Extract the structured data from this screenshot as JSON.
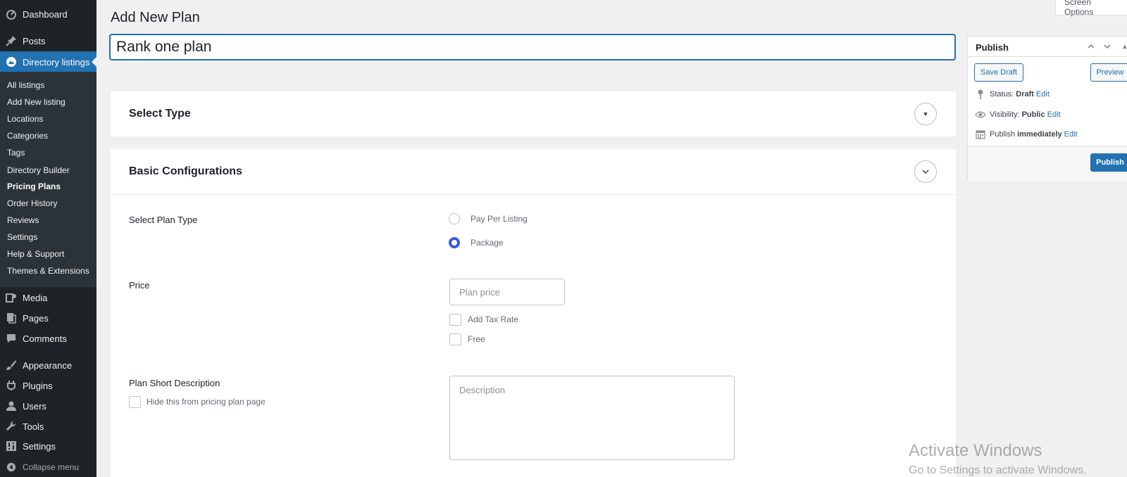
{
  "sidebar": {
    "top_items": [
      {
        "label": "Dashboard",
        "icon": "dashboard-icon"
      },
      {
        "label": "Posts",
        "icon": "pin-icon"
      },
      {
        "label": "Directory listings",
        "icon": "directory-icon"
      }
    ],
    "sub_items": [
      {
        "label": "All listings"
      },
      {
        "label": "Add New listing"
      },
      {
        "label": "Locations"
      },
      {
        "label": "Categories"
      },
      {
        "label": "Tags"
      },
      {
        "label": "Directory Builder"
      },
      {
        "label": "Pricing Plans"
      },
      {
        "label": "Order History"
      },
      {
        "label": "Reviews"
      },
      {
        "label": "Settings"
      },
      {
        "label": "Help & Support"
      },
      {
        "label": "Themes & Extensions"
      }
    ],
    "bottom_items": [
      {
        "label": "Media",
        "icon": "media-icon"
      },
      {
        "label": "Pages",
        "icon": "pages-icon"
      },
      {
        "label": "Comments",
        "icon": "comment-icon"
      },
      {
        "label": "Appearance",
        "icon": "brush-icon"
      },
      {
        "label": "Plugins",
        "icon": "plugin-icon"
      },
      {
        "label": "Users",
        "icon": "user-icon"
      },
      {
        "label": "Tools",
        "icon": "wrench-icon"
      },
      {
        "label": "Settings",
        "icon": "settings-icon"
      }
    ],
    "collapse_label": "Collapse menu"
  },
  "header": {
    "title": "Add New Plan",
    "screen_options": "Screen Options"
  },
  "title_input": {
    "value": "Rank one plan"
  },
  "select_type": {
    "title": "Select Type"
  },
  "basic_config": {
    "title": "Basic Configurations",
    "plan_type_label": "Select Plan Type",
    "plan_type_options": [
      "Pay Per Listing",
      "Package"
    ],
    "plan_type_selected": "Package",
    "price_label": "Price",
    "price_placeholder": "Plan price",
    "add_tax_label": "Add Tax Rate",
    "free_label": "Free",
    "short_desc_label": "Plan Short Description",
    "hide_label": "Hide this from pricing plan page",
    "description_placeholder": "Description"
  },
  "publish": {
    "title": "Publish",
    "save_draft": "Save Draft",
    "preview": "Preview",
    "status_label": "Status:",
    "status_value": "Draft",
    "visibility_label": "Visibility:",
    "visibility_value": "Public",
    "publish_label": "Publish",
    "publish_value": "immediately",
    "edit": "Edit",
    "publish_button": "Publish"
  },
  "watermark": {
    "line1": "Activate Windows",
    "line2": "Go to Settings to activate Windows."
  },
  "colors": {
    "sidebar_bg": "#1d2327",
    "submenu_bg": "#2c3338",
    "accent": "#2271b1",
    "radio_checked": "#3858e9"
  }
}
